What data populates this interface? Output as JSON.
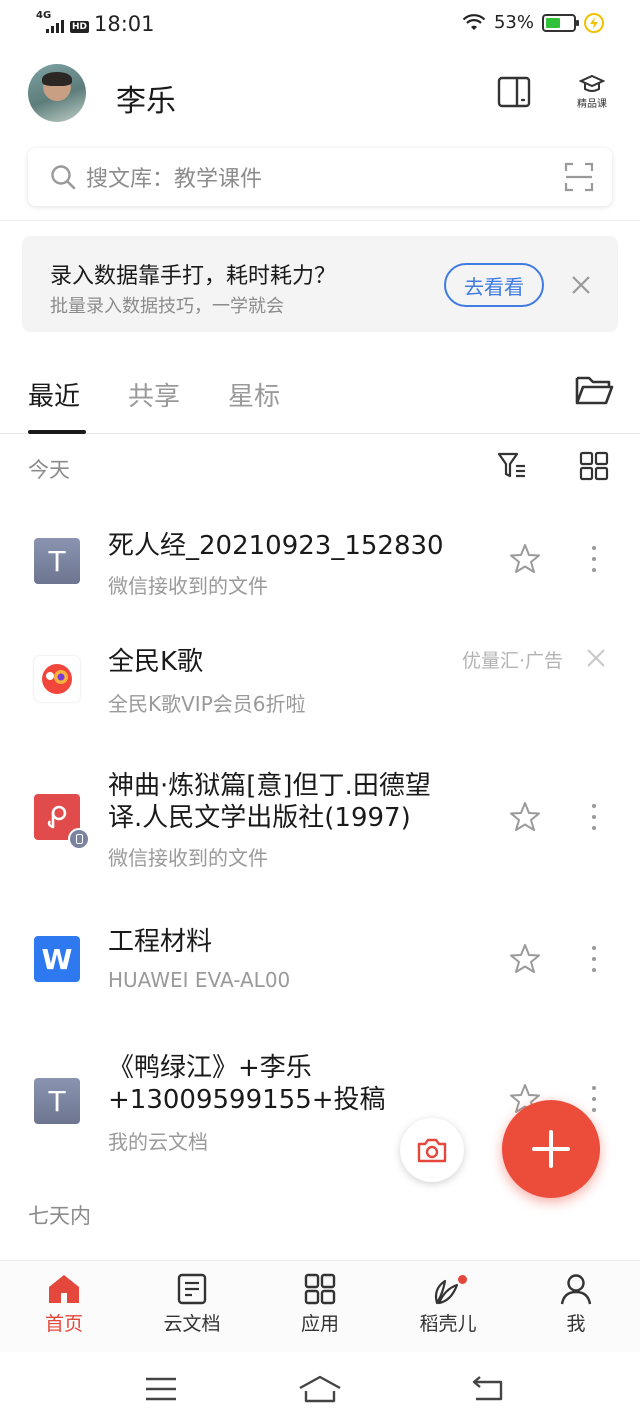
{
  "status_bar": {
    "network": "4G",
    "hd": "HD",
    "time": "18:01",
    "battery_percent": "53%",
    "battery_level": 0.53,
    "wifi_icon": "wifi-icon"
  },
  "header": {
    "username": "李乐",
    "premium_course_label": "精品课"
  },
  "search": {
    "placeholder": "搜文库：教学课件"
  },
  "promo": {
    "title": "录入数据靠手打，耗时耗力？",
    "subtitle": "批量录入数据技巧，一学就会",
    "cta": "去看看"
  },
  "tabs": [
    {
      "label": "最近",
      "active": true
    },
    {
      "label": "共享",
      "active": false
    },
    {
      "label": "星标",
      "active": false
    }
  ],
  "sections": {
    "today": "今天",
    "seven_days": "七天内"
  },
  "files": [
    {
      "icon": "T",
      "type": "text",
      "title": "死人经_20210923_152830",
      "subtitle": "微信接收到的文件"
    },
    {
      "icon": "kge",
      "type": "ad",
      "title": "全民K歌",
      "subtitle": "全民K歌VIP会员6折啦",
      "ad_label": "优量汇·广告"
    },
    {
      "icon": "pdf",
      "type": "pdf",
      "title_line1": "神曲·炼狱篇[意]但丁.田德望",
      "title_line2": "译.人民文学出版社(1997)",
      "subtitle": "微信接收到的文件"
    },
    {
      "icon": "W",
      "type": "word",
      "title": "工程材料",
      "subtitle": "HUAWEI EVA-AL00"
    },
    {
      "icon": "T",
      "type": "text",
      "title_line1": "《鸭绿江》+李乐",
      "title_line2": "+13009599155+投稿",
      "subtitle": "我的云文档"
    }
  ],
  "bottom_nav": [
    {
      "label": "首页",
      "icon": "home-icon",
      "active": true
    },
    {
      "label": "云文档",
      "icon": "document-icon",
      "active": false
    },
    {
      "label": "应用",
      "icon": "apps-grid-icon",
      "active": false
    },
    {
      "label": "稻壳儿",
      "icon": "leaf-icon",
      "active": false,
      "badge": true
    },
    {
      "label": "我",
      "icon": "person-icon",
      "active": false
    }
  ],
  "colors": {
    "accent": "#ec4c3a",
    "link": "#3f7be0",
    "word": "#2e79f0",
    "pdf": "#e14b4b",
    "text_icon": "#7b83a1"
  }
}
